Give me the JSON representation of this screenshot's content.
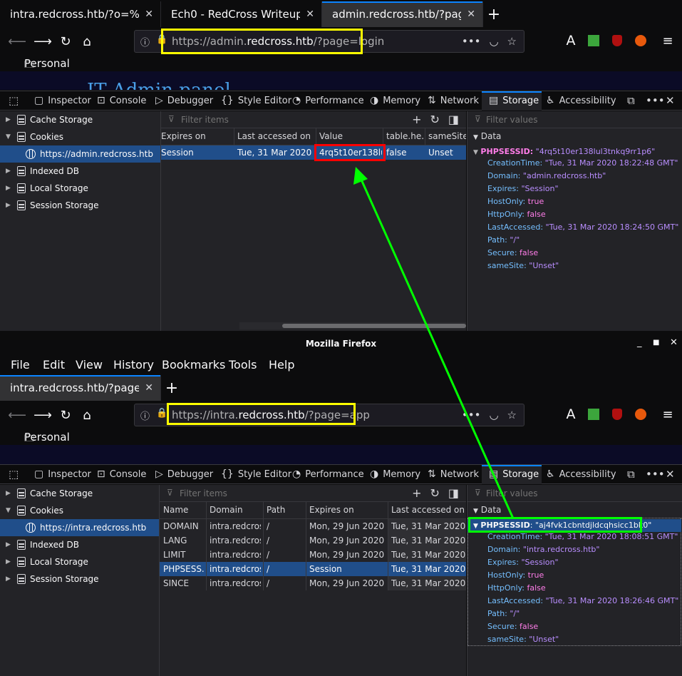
{
  "top_window": {
    "tabs": [
      {
        "label": "intra.redcross.htb/?o=%&pa",
        "close": "✕"
      },
      {
        "label": "Ech0 - RedCross Writeup",
        "close": "✕"
      },
      {
        "label": "admin.redcross.htb/?page=l",
        "close": "✕"
      }
    ],
    "new_tab": "+",
    "url": {
      "scheme": "https://admin.",
      "host": "redcross.htb",
      "path": "/?page=login"
    },
    "bookmarks_folder": "Personal",
    "page_heading_fragment": "IT Admin panel",
    "devtools": {
      "tabs": [
        "Inspector",
        "Console",
        "Debugger",
        "Style Editor",
        "Performance",
        "Memory",
        "Network",
        "Storage",
        "Accessibility"
      ],
      "active_tab": "Storage",
      "tree": [
        "Cache Storage",
        "Cookies",
        "https://admin.redcross.htb",
        "Indexed DB",
        "Local Storage",
        "Session Storage"
      ],
      "filter_placeholder": "Filter items",
      "filter_values_placeholder": "Filter values",
      "columns": [
        "Expires on",
        "Last accessed on",
        "Value",
        "table.he...",
        "sameSite"
      ],
      "rows": [
        {
          "expires": "Session",
          "last_accessed": "Tue, 31 Mar 2020 18...",
          "value": "4rq5t10er138lul...",
          "table_he": "false",
          "samesite": "Unset"
        }
      ],
      "data_header": "Data",
      "cookie": {
        "name": "PHPSESSID",
        "value": "\"4rq5t10er138lul3tnkq9rr1p6\"",
        "fields": [
          {
            "k": "CreationTime:",
            "v": "\"Tue, 31 Mar 2020 18:22:48 GMT\"",
            "t": "s"
          },
          {
            "k": "Domain:",
            "v": "\"admin.redcross.htb\"",
            "t": "s"
          },
          {
            "k": "Expires:",
            "v": "\"Session\"",
            "t": "s"
          },
          {
            "k": "HostOnly:",
            "v": "true",
            "t": "b"
          },
          {
            "k": "HttpOnly:",
            "v": "false",
            "t": "b"
          },
          {
            "k": "LastAccessed:",
            "v": "\"Tue, 31 Mar 2020 18:24:50 GMT\"",
            "t": "s"
          },
          {
            "k": "Path:",
            "v": "\"/\"",
            "t": "s"
          },
          {
            "k": "Secure:",
            "v": "false",
            "t": "b"
          },
          {
            "k": "sameSite:",
            "v": "\"Unset\"",
            "t": "s"
          }
        ]
      }
    }
  },
  "bottom_window": {
    "title": "Mozilla Firefox",
    "window_controls": [
      "_",
      "■",
      "✕"
    ],
    "menu": [
      "File",
      "Edit",
      "View",
      "History",
      "Bookmarks",
      "Tools",
      "Help"
    ],
    "tabs": [
      {
        "label": "intra.redcross.htb/?page=ap",
        "close": "✕"
      }
    ],
    "new_tab": "+",
    "url": {
      "scheme": "https://intra.",
      "host": "redcross.htb",
      "path": "/?page=app"
    },
    "bookmarks_folder": "Personal",
    "devtools": {
      "tabs": [
        "Inspector",
        "Console",
        "Debugger",
        "Style Editor",
        "Performance",
        "Memory",
        "Network",
        "Storage",
        "Accessibility"
      ],
      "active_tab": "Storage",
      "tree": [
        "Cache Storage",
        "Cookies",
        "https://intra.redcross.htb",
        "Indexed DB",
        "Local Storage",
        "Session Storage"
      ],
      "filter_placeholder": "Filter items",
      "filter_values_placeholder": "Filter values",
      "columns": [
        "Name",
        "Domain",
        "Path",
        "Expires on",
        "Last accessed on"
      ],
      "rows": [
        {
          "name": "DOMAIN",
          "domain": "intra.redcros...",
          "path": "/",
          "expires": "Mon, 29 Jun 2020 1...",
          "last": "Tue, 31 Mar 2020 18"
        },
        {
          "name": "LANG",
          "domain": "intra.redcros...",
          "path": "/",
          "expires": "Mon, 29 Jun 2020 1...",
          "last": "Tue, 31 Mar 2020 18"
        },
        {
          "name": "LIMIT",
          "domain": "intra.redcros...",
          "path": "/",
          "expires": "Mon, 29 Jun 2020 1...",
          "last": "Tue, 31 Mar 2020 18"
        },
        {
          "name": "PHPSESS...",
          "domain": "intra.redcros...",
          "path": "/",
          "expires": "Session",
          "last": "Tue, 31 Mar 2020 18"
        },
        {
          "name": "SINCE",
          "domain": "intra.redcros...",
          "path": "/",
          "expires": "Mon, 29 Jun 2020 1...",
          "last": "Tue, 31 Mar 2020 18"
        }
      ],
      "selected_row": 3,
      "data_header": "Data",
      "cookie": {
        "name": "PHPSESSID",
        "value": "\"aj4fvk1cbntdjldcqhsicc1bk0\"",
        "fields": [
          {
            "k": "CreationTime:",
            "v": "\"Tue, 31 Mar 2020 18:08:51 GMT\"",
            "t": "s"
          },
          {
            "k": "Domain:",
            "v": "\"intra.redcross.htb\"",
            "t": "s"
          },
          {
            "k": "Expires:",
            "v": "\"Session\"",
            "t": "s"
          },
          {
            "k": "HostOnly:",
            "v": "true",
            "t": "b"
          },
          {
            "k": "HttpOnly:",
            "v": "false",
            "t": "b"
          },
          {
            "k": "LastAccessed:",
            "v": "\"Tue, 31 Mar 2020 18:26:46 GMT\"",
            "t": "s"
          },
          {
            "k": "Path:",
            "v": "\"/\"",
            "t": "s"
          },
          {
            "k": "Secure:",
            "v": "false",
            "t": "b"
          },
          {
            "k": "sameSite:",
            "v": "\"Unset\"",
            "t": "s"
          }
        ]
      }
    }
  },
  "annotation_colors": {
    "url_highlight": "#ffff00",
    "value_highlight": "#ff0000",
    "cookie_highlight": "#00ff00",
    "arrow": "#00ff00"
  }
}
